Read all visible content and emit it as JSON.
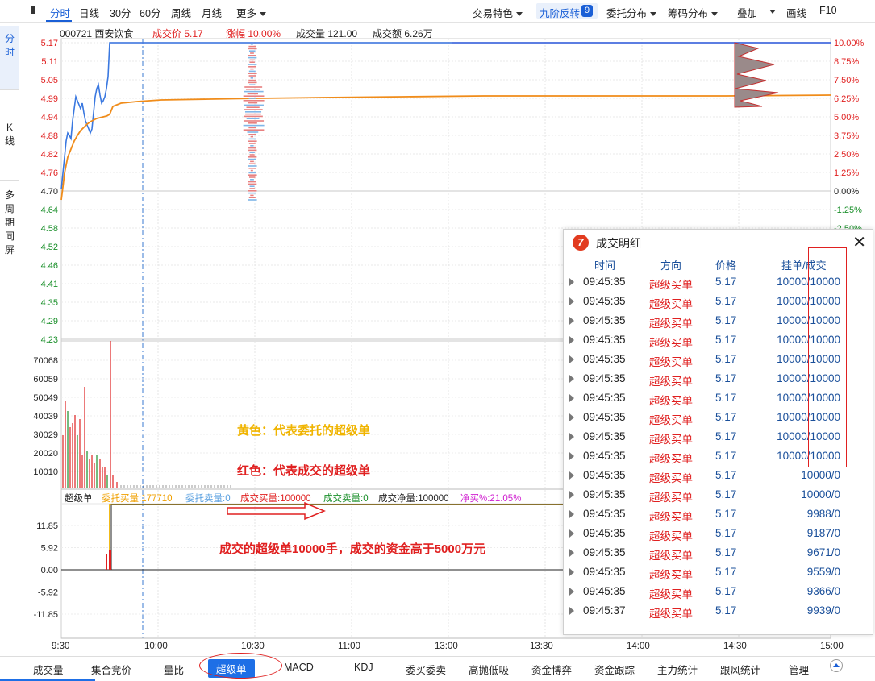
{
  "toolbar": {
    "fenshi": "分时",
    "rixian": "日线",
    "m30": "30分",
    "m60": "60分",
    "zhouxian": "周线",
    "yuexian": "月线",
    "more": "更多",
    "jiaoyi": "交易特色",
    "jiujie": "九阶反转",
    "jiujie_num": "9",
    "weituo": "委托分布",
    "chouma": "筹码分布",
    "diejia": "叠加",
    "huaxian": "画线",
    "f10": "F10"
  },
  "vtabs": {
    "fenshi": "分\n时",
    "kxian": "K\n线",
    "duozhouqi": "多\n周\n期\n同\n屏"
  },
  "info": {
    "code_name": "000721 西安饮食",
    "price": "成交价 5.17",
    "change": "涨幅 10.00%",
    "volume": "成交量 121.00",
    "amount": "成交额 6.26万"
  },
  "colors": {
    "up": "#e02020",
    "down": "#1a8f2a",
    "price_line": "#3a78e0",
    "avg_line": "#f08c1a",
    "accent": "#1e6fe6"
  },
  "price_axis": {
    "left": [
      "5.17",
      "5.11",
      "5.05",
      "4.99",
      "4.94",
      "4.88",
      "4.82",
      "4.76",
      "4.70",
      "4.64",
      "4.58",
      "4.52",
      "4.46",
      "4.41",
      "4.35",
      "4.29",
      "4.23"
    ],
    "right": [
      "10.00%",
      "8.75%",
      "7.50%",
      "6.25%",
      "5.00%",
      "3.75%",
      "2.50%",
      "1.25%",
      "0.00%",
      "-1.25%",
      "-2.50%"
    ]
  },
  "volume_axis": [
    "70068",
    "60059",
    "50049",
    "40039",
    "30029",
    "20020",
    "10010"
  ],
  "super_axis": [
    "11.85",
    "5.92",
    "0.00",
    "-5.92",
    "-11.85"
  ],
  "time_axis": [
    "9:30",
    "10:00",
    "10:30",
    "11:00",
    "13:00",
    "13:30",
    "14:00",
    "14:30",
    "15:00"
  ],
  "super_bar": {
    "title": "超级单",
    "buy_entrust": "委托买量:177710",
    "sell_entrust": "委托卖量:0",
    "buy_deal": "成交买量:100000",
    "sell_deal": "成交卖量:0",
    "net": "成交净量:100000",
    "net_pct": "净买%:21.05%"
  },
  "annotations": {
    "yellow": "黄色：代表委托的超级单",
    "red": "红色：代表成交的超级单",
    "deal": "成交的超级单10000手，成交的资金高于5000万元"
  },
  "popup": {
    "title": "成交明细",
    "logo": "7",
    "close": "✕",
    "cols": {
      "time": "时间",
      "dir": "方向",
      "price": "价格",
      "qty": "挂单/成交"
    },
    "rows": [
      {
        "time": "09:45:35",
        "dir": "超级买单",
        "price": "5.17",
        "qty": "10000/10000"
      },
      {
        "time": "09:45:35",
        "dir": "超级买单",
        "price": "5.17",
        "qty": "10000/10000"
      },
      {
        "time": "09:45:35",
        "dir": "超级买单",
        "price": "5.17",
        "qty": "10000/10000"
      },
      {
        "time": "09:45:35",
        "dir": "超级买单",
        "price": "5.17",
        "qty": "10000/10000"
      },
      {
        "time": "09:45:35",
        "dir": "超级买单",
        "price": "5.17",
        "qty": "10000/10000"
      },
      {
        "time": "09:45:35",
        "dir": "超级买单",
        "price": "5.17",
        "qty": "10000/10000"
      },
      {
        "time": "09:45:35",
        "dir": "超级买单",
        "price": "5.17",
        "qty": "10000/10000"
      },
      {
        "time": "09:45:35",
        "dir": "超级买单",
        "price": "5.17",
        "qty": "10000/10000"
      },
      {
        "time": "09:45:35",
        "dir": "超级买单",
        "price": "5.17",
        "qty": "10000/10000"
      },
      {
        "time": "09:45:35",
        "dir": "超级买单",
        "price": "5.17",
        "qty": "10000/10000"
      },
      {
        "time": "09:45:35",
        "dir": "超级买单",
        "price": "5.17",
        "qty": "10000/0"
      },
      {
        "time": "09:45:35",
        "dir": "超级买单",
        "price": "5.17",
        "qty": "10000/0"
      },
      {
        "time": "09:45:35",
        "dir": "超级买单",
        "price": "5.17",
        "qty": "9988/0"
      },
      {
        "time": "09:45:35",
        "dir": "超级买单",
        "price": "5.17",
        "qty": "9187/0"
      },
      {
        "time": "09:45:35",
        "dir": "超级买单",
        "price": "5.17",
        "qty": "9671/0"
      },
      {
        "time": "09:45:35",
        "dir": "超级买单",
        "price": "5.17",
        "qty": "9559/0"
      },
      {
        "time": "09:45:35",
        "dir": "超级买单",
        "price": "5.17",
        "qty": "9366/0"
      },
      {
        "time": "09:45:37",
        "dir": "超级买单",
        "price": "5.17",
        "qty": "9939/0"
      }
    ]
  },
  "bottom_tabs": [
    "成交量",
    "集合竞价",
    "量比",
    "超级单",
    "MACD",
    "KDJ",
    "委买委卖",
    "高抛低吸",
    "资金博弈",
    "资金跟踪",
    "主力统计",
    "跟风统计",
    "管理"
  ],
  "bottom_active": "超级单"
}
